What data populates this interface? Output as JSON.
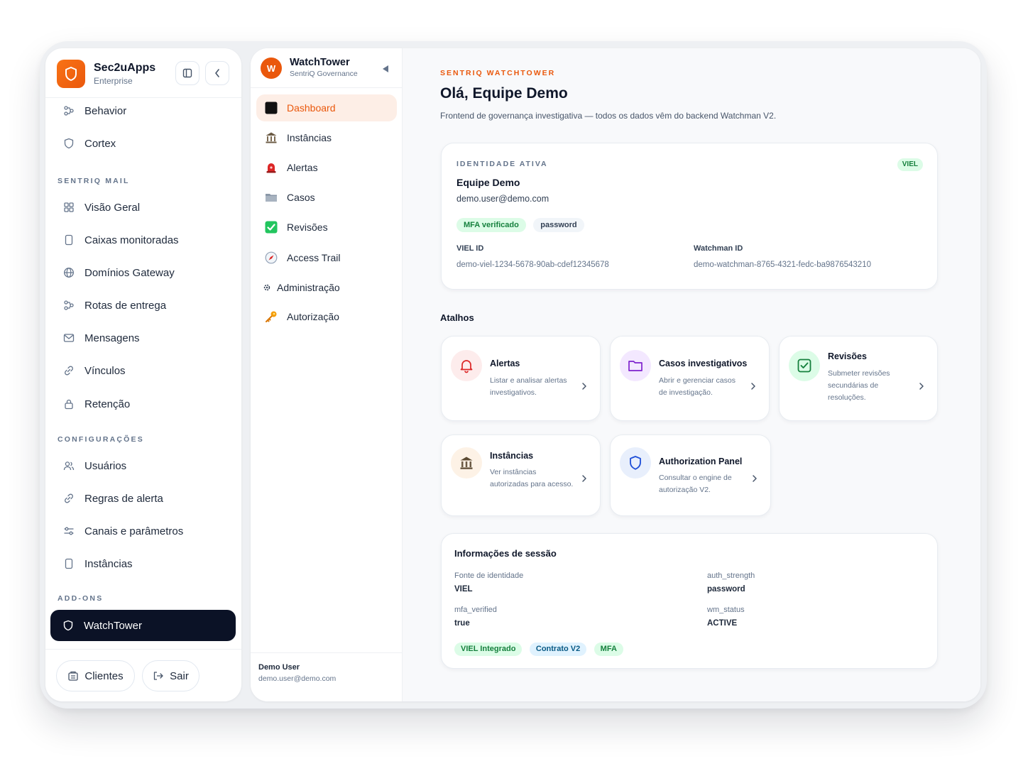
{
  "brand": {
    "name": "Sec2uApps",
    "subtitle": "Enterprise"
  },
  "sidebar": {
    "top_items": [
      {
        "label": "Behavior",
        "icon": "nodes-icon"
      },
      {
        "label": "Cortex",
        "icon": "shield-outline-icon"
      }
    ],
    "section_mail": "SENTRIQ MAIL",
    "mail_items": [
      {
        "label": "Visão Geral",
        "icon": "grid-icon"
      },
      {
        "label": "Caixas monitoradas",
        "icon": "device-icon"
      },
      {
        "label": "Domínios Gateway",
        "icon": "globe-icon"
      },
      {
        "label": "Rotas de entrega",
        "icon": "nodes-icon"
      },
      {
        "label": "Mensagens",
        "icon": "mail-icon"
      },
      {
        "label": "Vínculos",
        "icon": "link-icon"
      },
      {
        "label": "Retenção",
        "icon": "lock-icon"
      }
    ],
    "section_config": "CONFIGURAÇÕES",
    "config_items": [
      {
        "label": "Usuários",
        "icon": "users-icon"
      },
      {
        "label": "Regras de alerta",
        "icon": "link-icon"
      },
      {
        "label": "Canais e parâmetros",
        "icon": "sliders-icon"
      },
      {
        "label": "Instâncias",
        "icon": "device-icon"
      }
    ],
    "section_addons": "ADD-ONS",
    "active_item": {
      "label": "WatchTower",
      "icon": "shield-outline-icon"
    },
    "footer": {
      "clients_label": "Clientes",
      "logout_label": "Sair"
    }
  },
  "watchtower_nav": {
    "avatar_letter": "W",
    "title": "WatchTower",
    "subtitle": "SentriQ Governance",
    "items": [
      {
        "label": "Dashboard",
        "icon": "black-square-icon",
        "active": true
      },
      {
        "label": "Instâncias",
        "icon": "bank-icon"
      },
      {
        "label": "Alertas",
        "icon": "siren-icon"
      },
      {
        "label": "Casos",
        "icon": "folder-icon"
      },
      {
        "label": "Revisões",
        "icon": "check-box-icon"
      },
      {
        "label": "Access Trail",
        "icon": "compass-icon"
      },
      {
        "label": "Administração",
        "icon": "gear-icon"
      },
      {
        "label": "Autorização",
        "icon": "key-icon"
      }
    ],
    "user": {
      "name": "Demo User",
      "email": "demo.user@demo.com"
    }
  },
  "main": {
    "eyebrow": "SENTRIQ WATCHTOWER",
    "greeting": "Olá, Equipe Demo",
    "subtitle": "Frontend de governança investigativa — todos os dados vêm do backend Watchman V2.",
    "identity": {
      "label": "IDENTIDADE ATIVA",
      "badge": "VIEL",
      "name": "Equipe Demo",
      "email": "demo.user@demo.com",
      "pills": [
        "MFA verificado",
        "password"
      ],
      "viel_id_label": "VIEL ID",
      "viel_id_value": "demo-viel-1234-5678-90ab-cdef12345678",
      "watchman_id_label": "Watchman ID",
      "watchman_id_value": "demo-watchman-8765-4321-fedc-ba9876543210"
    },
    "shortcuts_title": "Atalhos",
    "shortcuts": [
      {
        "title": "Alertas",
        "desc": "Listar e analisar alertas investigativos.",
        "icon": "bell-icon",
        "color": "#dc2626"
      },
      {
        "title": "Casos investigativos",
        "desc": "Abrir e gerenciar casos de investigação.",
        "icon": "folder-icon",
        "color": "#7e22ce"
      },
      {
        "title": "Revisões",
        "desc": "Submeter revisões secundárias de resoluções.",
        "icon": "check-box-icon",
        "color": "#15803d"
      },
      {
        "title": "Instâncias",
        "desc": "Ver instâncias autorizadas para acesso.",
        "icon": "bank-icon",
        "color": "#92400e"
      },
      {
        "title": "Authorization Panel",
        "desc": "Consultar o engine de autorização V2.",
        "icon": "shield-outline-icon",
        "color": "#1d4ed8"
      }
    ],
    "session": {
      "title": "Informações de sessão",
      "fields": [
        {
          "key": "Fonte de identidade",
          "value": "VIEL"
        },
        {
          "key": "auth_strength",
          "value": "password"
        },
        {
          "key": "mfa_verified",
          "value": "true"
        },
        {
          "key": "wm_status",
          "value": "ACTIVE"
        }
      ],
      "pills": [
        "VIEL Integrado",
        "Contrato V2",
        "MFA"
      ]
    }
  },
  "colors": {
    "accent": "#ea580c",
    "active_nav_bg": "#0b1226",
    "success": "#15803d"
  }
}
